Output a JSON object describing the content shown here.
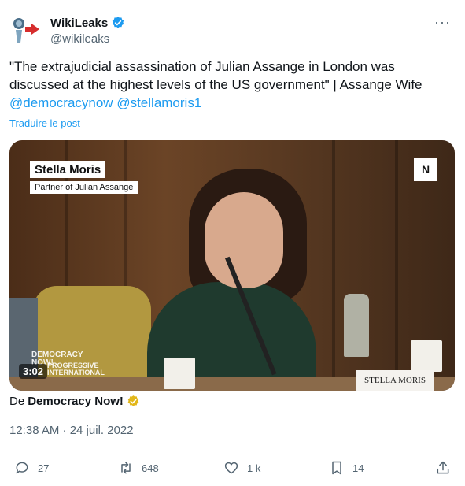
{
  "tweet": {
    "author_name": "WikiLeaks",
    "author_handle": "@wikileaks",
    "more_label": "···",
    "text_main": "\"The extrajudicial assassination of Julian Assange in London was discussed at the highest levels of the US government\" | Assange Wife",
    "mention1": "@democracynow",
    "mention2": "@stellamoris1",
    "translate_label": "Traduire le post",
    "source_prefix": "De",
    "source_name": "Democracy Now!",
    "timestamp": "12:38 AM · 24 juil. 2022"
  },
  "video": {
    "lower_third_name": "Stella Moris",
    "lower_third_role": "Partner of Julian Assange",
    "logo_text": "N",
    "watermark_dn": "DEMOCRACY NOW!",
    "watermark_pi": "PROGRESSIVE INTERNATIONAL",
    "placard_text": "STELLA MORIS",
    "duration": "3:02"
  },
  "actions": {
    "replies": "27",
    "reposts": "648",
    "likes": "1 k",
    "bookmarks": "14"
  },
  "colors": {
    "link": "#1d9bf0",
    "verified": "#1d9bf0",
    "gold_badge": "#e2b719",
    "muted": "#536471"
  },
  "icons": [
    "wikileaks-avatar-icon",
    "verified-icon",
    "gold-check-icon",
    "reply-icon",
    "repost-icon",
    "like-icon",
    "bookmark-icon",
    "share-icon"
  ]
}
